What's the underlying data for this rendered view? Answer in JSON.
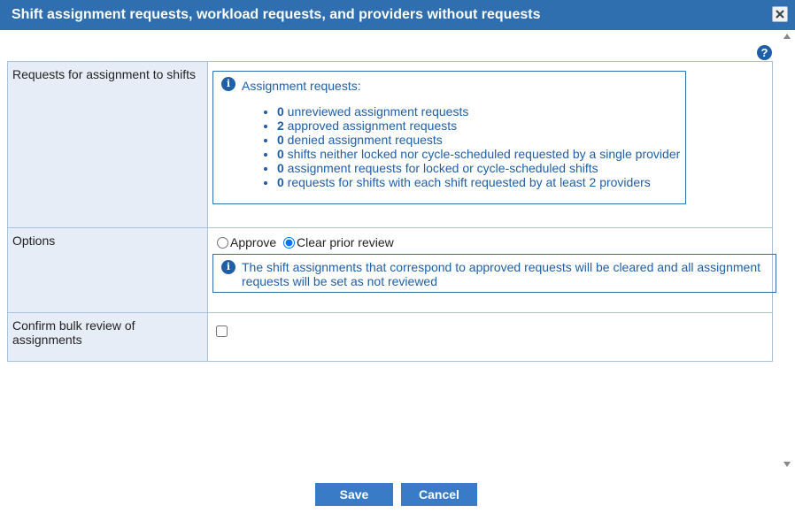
{
  "dialog": {
    "title": "Shift assignment requests, workload requests, and providers without requests",
    "help_label": "?"
  },
  "rows": {
    "requests": {
      "label": "Requests for assignment to shifts",
      "info_heading": "Assignment requests:",
      "items": [
        {
          "count": "0",
          "text": " unreviewed assignment requests"
        },
        {
          "count": "2",
          "text": " approved assignment requests"
        },
        {
          "count": "0",
          "text": " denied assignment requests"
        },
        {
          "count": "0",
          "text": " shifts neither locked nor cycle-scheduled requested by a single provider"
        },
        {
          "count": "0",
          "text": " assignment requests for locked or cycle-scheduled shifts"
        },
        {
          "count": "0",
          "text": " requests for shifts with each shift requested by at least 2 providers"
        }
      ]
    },
    "options": {
      "label": "Options",
      "approve_label": "Approve",
      "clear_label": "Clear prior review",
      "selected": "Clear prior review",
      "info_text": "The shift assignments that correspond to approved requests will be cleared and all assignment requests will be set as not reviewed"
    },
    "confirm": {
      "label": "Confirm bulk review of assignments",
      "checked": false
    }
  },
  "footer": {
    "save_label": "Save",
    "cancel_label": "Cancel"
  },
  "colors": {
    "titlebar": "#2f6fb0",
    "label_bg": "#e7edf6",
    "info_text": "#1f5fa8",
    "button": "#3a7bc8"
  }
}
